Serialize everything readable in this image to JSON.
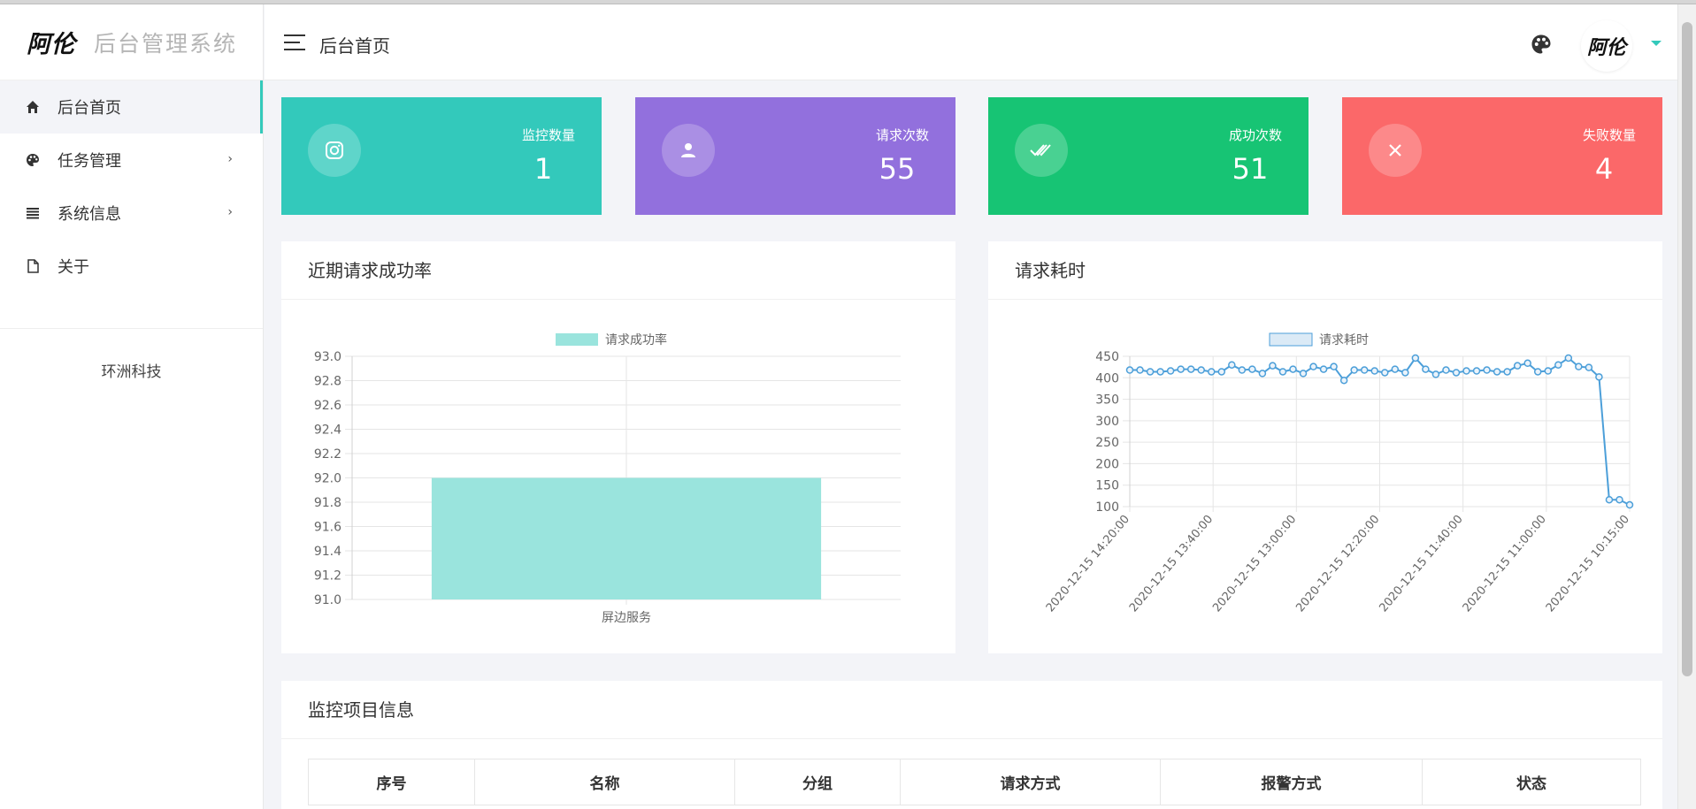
{
  "brand": {
    "logo": "阿伦",
    "title": "后台管理系统"
  },
  "sidebar": {
    "items": [
      {
        "label": "后台首页",
        "icon": "home-icon",
        "active": true,
        "has_arrow": false
      },
      {
        "label": "任务管理",
        "icon": "palette-icon",
        "active": false,
        "has_arrow": true
      },
      {
        "label": "系统信息",
        "icon": "list-icon",
        "active": false,
        "has_arrow": true
      },
      {
        "label": "关于",
        "icon": "file-icon",
        "active": false,
        "has_arrow": false
      }
    ],
    "footer": "环洲科技"
  },
  "header": {
    "title": "后台首页",
    "avatar_text": "阿伦"
  },
  "stats": [
    {
      "label": "监控数量",
      "value": "1",
      "color": "#33c9bb",
      "icon": "instagram-icon"
    },
    {
      "label": "请求次数",
      "value": "55",
      "color": "#9270dd",
      "icon": "user-icon"
    },
    {
      "label": "成功次数",
      "value": "51",
      "color": "#17c474",
      "icon": "double-check-icon"
    },
    {
      "label": "失败数量",
      "value": "4",
      "color": "#fb6869",
      "icon": "close-icon"
    }
  ],
  "panels": {
    "success_rate": {
      "title": "近期请求成功率"
    },
    "latency": {
      "title": "请求耗时"
    },
    "projects": {
      "title": "监控项目信息",
      "columns": [
        "序号",
        "名称",
        "分组",
        "请求方式",
        "报警方式",
        "状态"
      ]
    }
  },
  "chart_data": [
    {
      "type": "bar",
      "legend": "请求成功率",
      "categories": [
        "屏边服务"
      ],
      "values": [
        92.0
      ],
      "ylim": [
        91.0,
        93.0
      ],
      "yticks": [
        93.0,
        92.8,
        92.6,
        92.4,
        92.2,
        92.0,
        91.8,
        91.6,
        91.4,
        91.2,
        91.0
      ],
      "color": "#9ae4dd",
      "grid": true,
      "legend_position": "top"
    },
    {
      "type": "line",
      "legend": "请求耗时",
      "values": [
        418,
        418,
        414,
        414,
        416,
        420,
        420,
        418,
        414,
        414,
        430,
        418,
        420,
        410,
        428,
        414,
        420,
        410,
        426,
        420,
        426,
        394,
        418,
        418,
        416,
        412,
        420,
        412,
        446,
        420,
        408,
        418,
        412,
        416,
        416,
        418,
        414,
        414,
        428,
        434,
        414,
        416,
        430,
        446,
        426,
        424,
        402,
        116,
        116,
        104
      ],
      "xtick_labels": [
        "2020-12-15 14:20:00",
        "2020-12-15 13:40:00",
        "2020-12-15 13:00:00",
        "2020-12-15 12:20:00",
        "2020-12-15 11:40:00",
        "2020-12-15 11:00:00",
        "2020-12-15 10:15:00"
      ],
      "ylim": [
        100,
        450
      ],
      "yticks": [
        450,
        400,
        350,
        300,
        250,
        200,
        150,
        100
      ],
      "color": "#4c9fd9",
      "grid": true,
      "legend_position": "top"
    }
  ]
}
